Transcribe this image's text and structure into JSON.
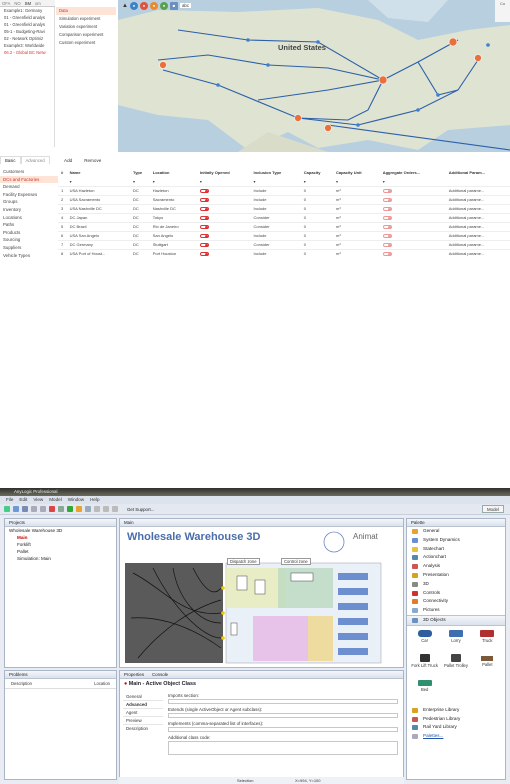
{
  "top": {
    "scenario_tabs": [
      "GFA",
      "NO",
      "SM",
      "om"
    ],
    "scenario_list": [
      "Example1: Germany",
      "01 - Greenfield analys",
      "01 - Greenfield analys",
      "05-1 - Budgeting-Ravi",
      "02 - Network Optimiz",
      "Example3: Worldwide",
      "06.2 - Global BC Netw"
    ],
    "experiments": [
      "Data",
      "Simulation experiment",
      "Variation experiment",
      "Comparison experiment",
      "Custom experiment"
    ],
    "map": {
      "country_label": "United States",
      "toolbar_text": "abc",
      "right_btn": "Co"
    },
    "bottom_tabs": [
      "Basic",
      "Advanced"
    ],
    "categories": [
      "Customers",
      "DCs and Factories",
      "Demand",
      "Facility Expenses",
      "Groups",
      "Inventory",
      "Locations",
      "Paths",
      "Products",
      "Sourcing",
      "Suppliers",
      "Vehicle Types"
    ],
    "toolbar": {
      "add": "Add",
      "remove": "Remove"
    },
    "columns": [
      "#",
      "Name",
      "Type",
      "Location",
      "Initially Opened",
      "Inclusion Type",
      "Capacity",
      "Capacity Unit",
      "Aggregate Orders...",
      "Additional Param..."
    ],
    "rows": [
      [
        "1",
        "USA Hazleton",
        "DC",
        "Hazleton",
        "on",
        "Include",
        "0",
        "m³",
        "Additional parame..."
      ],
      [
        "2",
        "USA Sacramento",
        "DC",
        "Sacramento",
        "on",
        "Include",
        "0",
        "m³",
        "Additional parame..."
      ],
      [
        "3",
        "USA Nashville DC",
        "DC",
        "Nashville DC",
        "on",
        "Include",
        "0",
        "m³",
        "Additional parame..."
      ],
      [
        "4",
        "DC Japan",
        "DC",
        "Tokyo",
        "on",
        "Consider",
        "0",
        "m³",
        "Additional parame..."
      ],
      [
        "5",
        "DC Brazil",
        "DC",
        "Rio de Janeiro",
        "on",
        "Consider",
        "0",
        "m³",
        "Additional parame..."
      ],
      [
        "6",
        "USA San Angelo",
        "DC",
        "San Angelo",
        "on",
        "Include",
        "0",
        "m³",
        "Additional parame..."
      ],
      [
        "7",
        "DC Germany",
        "DC",
        "Stuttgart",
        "on",
        "Consider",
        "0",
        "m³",
        "Additional parame..."
      ],
      [
        "8",
        "USA Port of Houst...",
        "DC",
        "Port Houston",
        "on",
        "Include",
        "0",
        "m³",
        "Additional parame..."
      ]
    ]
  },
  "anylogic": {
    "title": "AnyLogic Professional",
    "menus": [
      "File",
      "Edit",
      "View",
      "Model",
      "Window",
      "Help"
    ],
    "get_support": "Get Support...",
    "model_btn": "Model",
    "projects_tab": "Projects",
    "tree": [
      "Wholesale Warehouse 3D",
      "Main",
      "Forklift",
      "Pallet",
      "Simulation: Main"
    ],
    "editor_tab": "Main",
    "canvas_title": "Wholesale Warehouse 3D",
    "canvas_right": "Animat",
    "zone_dispatch": "Dispatch zone",
    "zone_control": "Control zone",
    "problems_tab": "Problems",
    "problems_cols": [
      "Description",
      "Location"
    ],
    "props_tabs": [
      "Properties",
      "Console"
    ],
    "props_title": "Main - Active Object Class",
    "props_sections": [
      "General",
      "Advanced",
      "Agent",
      "Preview",
      "Description"
    ],
    "props_fields": [
      "Imports section:",
      "Extends (single ActiveObject or Agent subclass):",
      "Implements (comma-separated list of interfaces):",
      "Additional class code:"
    ],
    "palette_tab": "Palette",
    "palette_items": [
      "General",
      "System Dynamics",
      "Statechart",
      "Actionchart",
      "Analysis",
      "Presentation",
      "3D",
      "Controls",
      "Connectivity",
      "Pictures",
      "3D Objects"
    ],
    "objects_3d": [
      "Car",
      "Lorry",
      "Truck",
      "Fork Lift Truck",
      "Pallet Trolley",
      "Pallet",
      "Bed"
    ],
    "libraries": [
      "Enterprise Library",
      "Pedestrian Library",
      "Rail Yard Library",
      "Palettes..."
    ],
    "status": {
      "label": "Selection",
      "coords": "X=994, Y=100"
    },
    "colors": {
      "brand": "#d33",
      "map_water": "#b8cfe0",
      "route": "#2c5fa8"
    }
  }
}
